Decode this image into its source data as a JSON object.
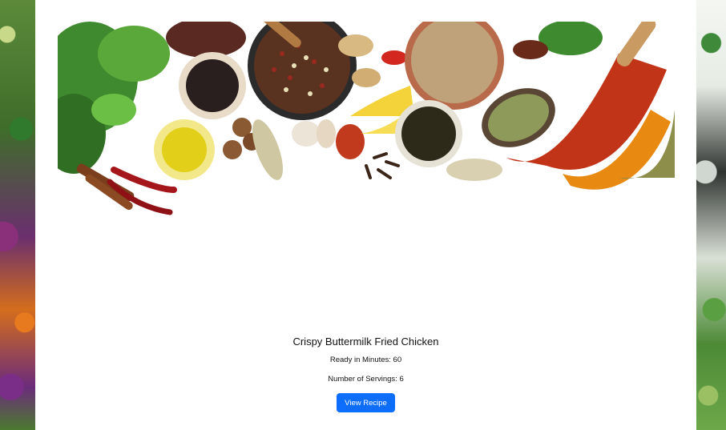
{
  "recipe": {
    "title": "Crispy Buttermilk Fried Chicken",
    "ready_label": "Ready in Minutes: 60",
    "servings_label": "Number of Servings: 6",
    "view_button_label": "View Recipe"
  },
  "colors": {
    "button": "#0d6efd",
    "card_background": "#ffffff"
  }
}
